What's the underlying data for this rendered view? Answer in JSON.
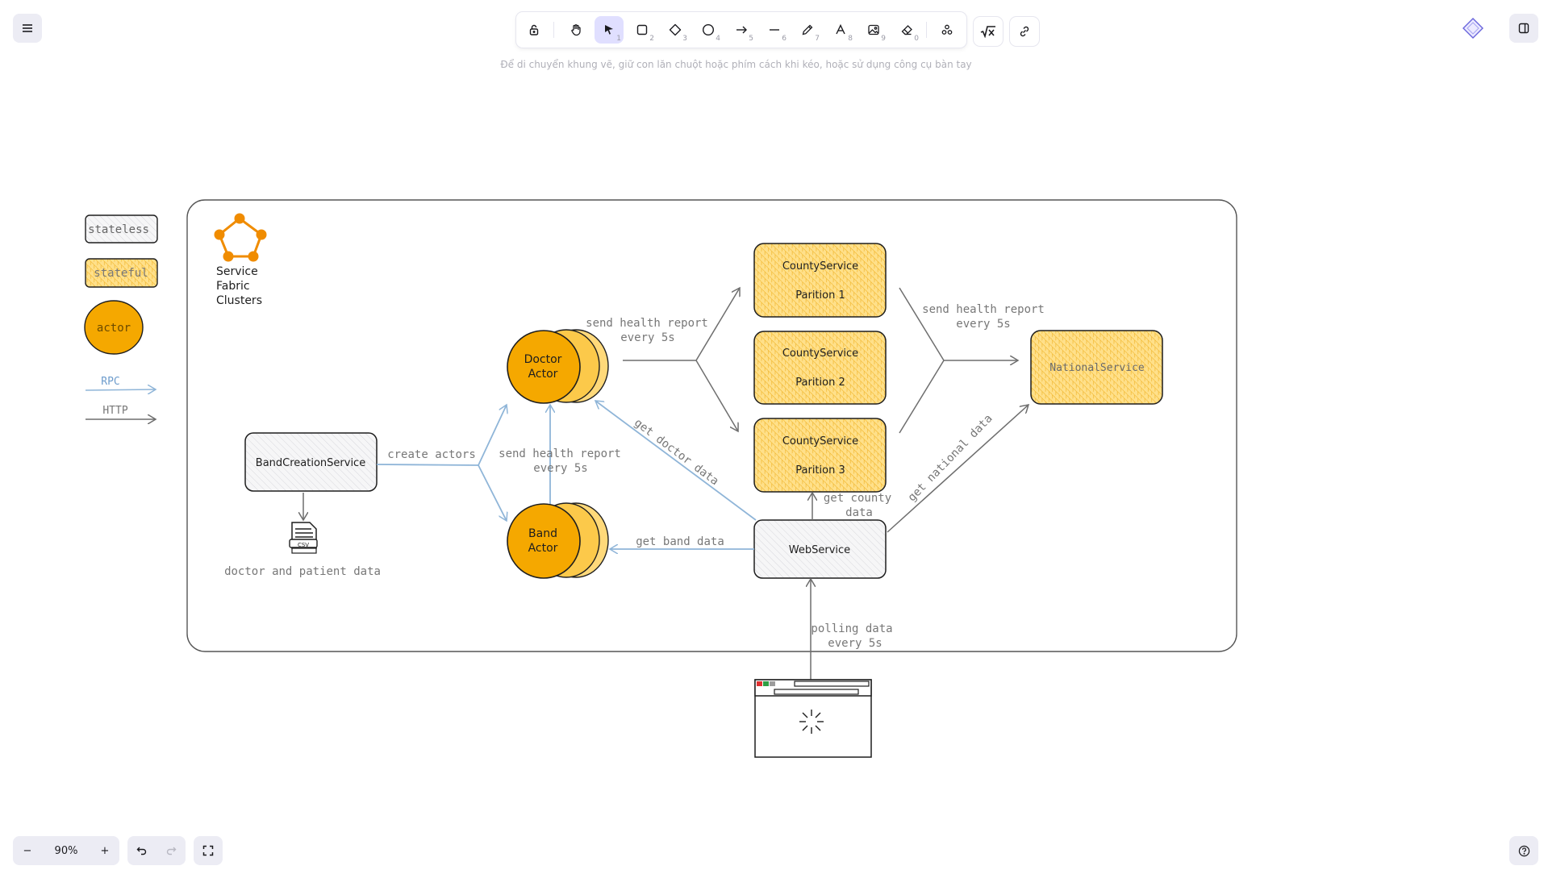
{
  "toolbar": {
    "tools": [
      {
        "name": "lock",
        "num": ""
      },
      {
        "name": "hand",
        "num": ""
      },
      {
        "name": "selection",
        "num": "1"
      },
      {
        "name": "rectangle",
        "num": "2"
      },
      {
        "name": "diamond",
        "num": "3"
      },
      {
        "name": "ellipse",
        "num": "4"
      },
      {
        "name": "arrow",
        "num": "5"
      },
      {
        "name": "line",
        "num": "6"
      },
      {
        "name": "draw",
        "num": "7"
      },
      {
        "name": "text",
        "num": "8"
      },
      {
        "name": "image",
        "num": "9"
      },
      {
        "name": "eraser",
        "num": "0"
      },
      {
        "name": "extra-tools",
        "num": ""
      }
    ],
    "active_tool": "selection"
  },
  "hint": "Để di chuyển khung vẽ, giữ con lăn chuột hoặc phím cách khi kéo, hoặc sử dụng công cụ bàn tay",
  "zoom": {
    "level": "90%",
    "minus": "−",
    "plus": "+"
  },
  "colors": {
    "stateful_fill": "#ffd97a",
    "actor_fill": "#f5a800",
    "cluster_orange": "#f08c00",
    "rpc_blue": "#8fb5d8",
    "stroke": "#1e1e1e",
    "grey_arrow": "#777777",
    "active_tool_bg": "#e0dfff"
  },
  "legend": {
    "stateless": "stateless",
    "stateful": "stateful",
    "actor": "actor",
    "rpc": "RPC",
    "http": "HTTP"
  },
  "cluster": {
    "l1": "Service",
    "l2": "Fabric",
    "l3": "Clusters"
  },
  "nodes": {
    "band_creation": "BandCreationService",
    "csv_label": "CSV",
    "csv_caption": "doctor and patient data",
    "doctor_actor_1": "Doctor",
    "doctor_actor_2": "Actor",
    "band_actor_1": "Band",
    "band_actor_2": "Actor",
    "county_name": "CountyService",
    "county_p1": "Parition 1",
    "county_p2": "Parition 2",
    "county_p3": "Parition 3",
    "web_service": "WebService",
    "national_service": "NationalService"
  },
  "edge_labels": {
    "create_actors": "create actors",
    "send_health_1a": "send health report",
    "send_health_1b": "every 5s",
    "send_health_2a": "send health report",
    "send_health_2b": "every 5s",
    "send_health_3a": "send health report",
    "send_health_3b": "every 5s",
    "get_doctor_data": "get doctor data",
    "get_band_data": "get band data",
    "get_county_a": "get county",
    "get_county_b": "data",
    "get_national_data": "get national data",
    "polling_a": "polling data",
    "polling_b": "every 5s"
  }
}
